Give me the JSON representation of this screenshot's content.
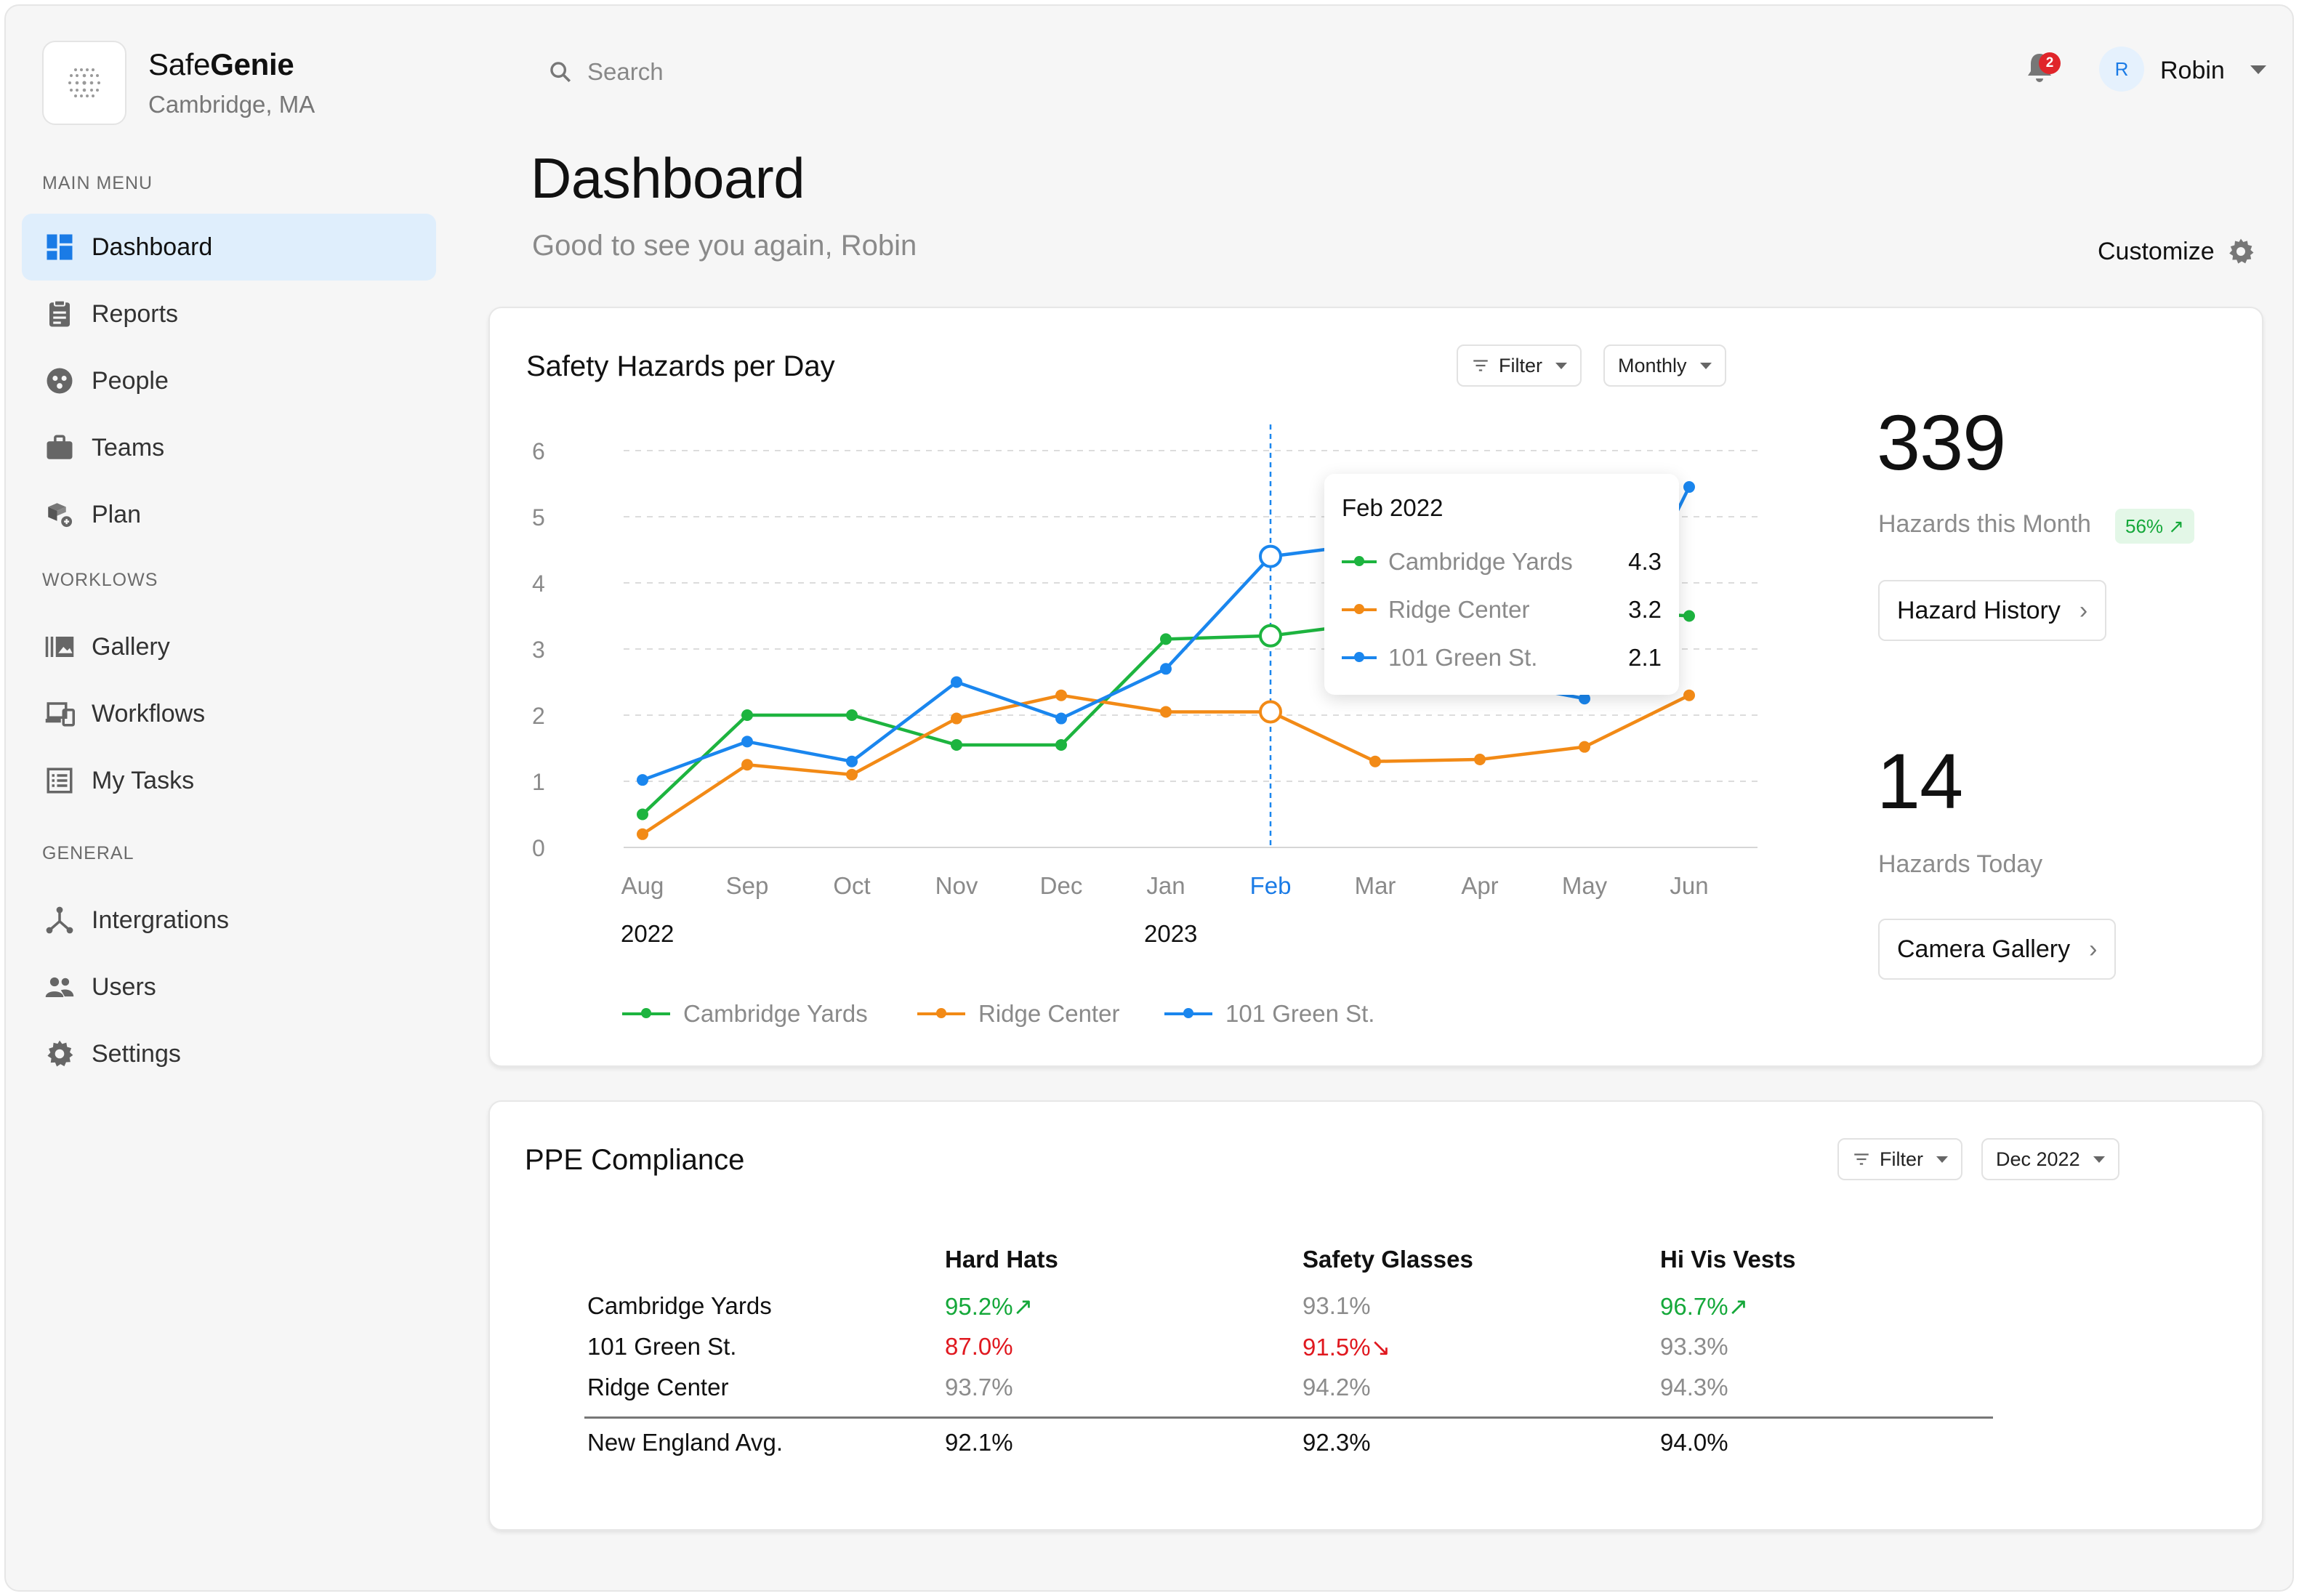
{
  "brand": {
    "name_regular": "Safe",
    "name_bold": "Genie",
    "location": "Cambridge, MA"
  },
  "sidebar": {
    "sections": [
      {
        "label": "MAIN MENU",
        "items": [
          {
            "label": "Dashboard",
            "icon": "dashboard-icon",
            "active": true
          },
          {
            "label": "Reports",
            "icon": "clipboard-icon"
          },
          {
            "label": "People",
            "icon": "people-icon"
          },
          {
            "label": "Teams",
            "icon": "briefcase-icon"
          },
          {
            "label": "Plan",
            "icon": "boxes-icon"
          }
        ]
      },
      {
        "label": "WORKLOWS",
        "items": [
          {
            "label": "Gallery",
            "icon": "gallery-icon"
          },
          {
            "label": "Workflows",
            "icon": "devices-icon"
          },
          {
            "label": "My Tasks",
            "icon": "tasks-icon"
          }
        ]
      },
      {
        "label": "GENERAL",
        "items": [
          {
            "label": "Intergrations",
            "icon": "integrations-icon"
          },
          {
            "label": "Users",
            "icon": "users-icon"
          },
          {
            "label": "Settings",
            "icon": "settings-icon"
          }
        ]
      }
    ]
  },
  "header": {
    "search_placeholder": "Search",
    "notification_count": "2",
    "user_initial": "R",
    "user_name": "Robin"
  },
  "page": {
    "title": "Dashboard",
    "subtitle": "Good to see you again, Robin",
    "customize_label": "Customize"
  },
  "hazards_card": {
    "title": "Safety Hazards per Day",
    "filter_label": "Filter",
    "period_label": "Monthly",
    "month_total": "339",
    "month_label": "Hazards this Month",
    "month_trend": "56% ↗",
    "history_button": "Hazard History",
    "today_total": "14",
    "today_label": "Hazards Today",
    "gallery_button": "Camera Gallery",
    "tooltip": {
      "title": "Feb 2022",
      "rows": [
        {
          "label": "Cambridge Yards",
          "value": "4.3"
        },
        {
          "label": "Ridge Center",
          "value": "3.2"
        },
        {
          "label": "101 Green St.",
          "value": "2.1"
        }
      ]
    }
  },
  "chart_data": {
    "type": "line",
    "title": "Safety Hazards per Day",
    "categories": [
      "Aug",
      "Sep",
      "Oct",
      "Nov",
      "Dec",
      "Jan",
      "Feb",
      "Mar",
      "Apr",
      "May",
      "Jun"
    ],
    "year_labels": [
      {
        "label": "2022",
        "at": "Aug"
      },
      {
        "label": "2023",
        "at": "Jan"
      }
    ],
    "highlighted_category": "Feb",
    "ylim": [
      0,
      6
    ],
    "yticks": [
      0,
      1,
      2,
      3,
      4,
      5,
      6
    ],
    "grid": true,
    "legend_position": "bottom-left",
    "series": [
      {
        "name": "Cambridge Yards",
        "color": "#1db43f",
        "values": [
          0.5,
          2.0,
          2.0,
          1.55,
          1.55,
          3.15,
          3.2,
          3.4,
          3.6,
          3.6,
          3.5
        ]
      },
      {
        "name": "Ridge Center",
        "color": "#f28a16",
        "values": [
          0.2,
          1.25,
          1.1,
          1.95,
          2.3,
          2.05,
          2.05,
          1.3,
          1.33,
          1.52,
          2.3
        ]
      },
      {
        "name": "101 Green St.",
        "color": "#1a86ee",
        "values": [
          1.02,
          1.6,
          1.3,
          2.5,
          1.95,
          2.7,
          4.4,
          4.6,
          2.55,
          2.25,
          5.45
        ]
      }
    ]
  },
  "ppe_card": {
    "title": "PPE Compliance",
    "filter_label": "Filter",
    "period_label": "Dec 2022",
    "columns": [
      "Hard Hats",
      "Safety Glasses",
      "Hi Vis Vests"
    ],
    "rows": [
      {
        "label": "Cambridge Yards",
        "cells": [
          {
            "value": "95.2%",
            "status": "green",
            "arrow": "↗"
          },
          {
            "value": "93.1%",
            "status": "gray",
            "arrow": ""
          },
          {
            "value": "96.7%",
            "status": "green",
            "arrow": "↗"
          }
        ]
      },
      {
        "label": "101 Green St.",
        "cells": [
          {
            "value": "87.0%",
            "status": "red",
            "arrow": ""
          },
          {
            "value": "91.5%",
            "status": "red",
            "arrow": "↘"
          },
          {
            "value": "93.3%",
            "status": "gray",
            "arrow": ""
          }
        ]
      },
      {
        "label": "Ridge Center",
        "cells": [
          {
            "value": "93.7%",
            "status": "gray",
            "arrow": ""
          },
          {
            "value": "94.2%",
            "status": "gray",
            "arrow": ""
          },
          {
            "value": "94.3%",
            "status": "gray",
            "arrow": ""
          }
        ]
      }
    ],
    "average": {
      "label": "New England Avg.",
      "values": [
        "92.1%",
        "92.3%",
        "94.0%"
      ]
    }
  }
}
